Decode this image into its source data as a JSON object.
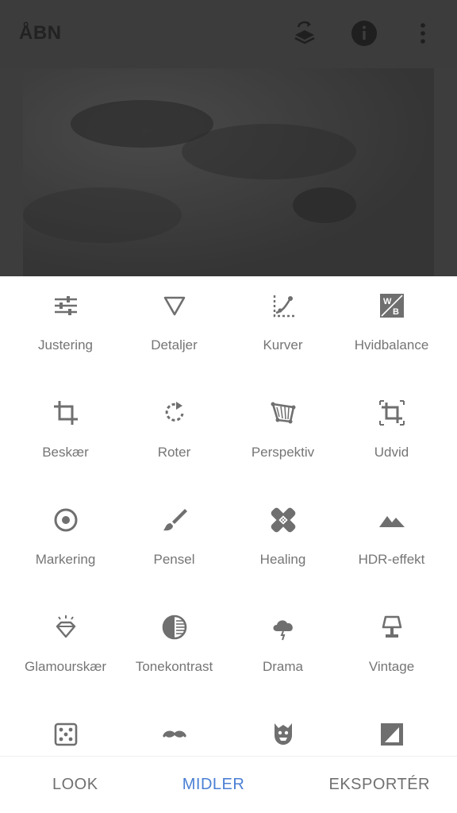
{
  "header": {
    "title": "ÅBN",
    "icons": [
      "stack-swap-icon",
      "info-icon",
      "more-vert-icon"
    ]
  },
  "tools": [
    {
      "label": "Justering",
      "icon": "sliders-icon"
    },
    {
      "label": "Detaljer",
      "icon": "triangle-icon"
    },
    {
      "label": "Kurver",
      "icon": "curves-icon"
    },
    {
      "label": "Hvidbalance",
      "icon": "white-balance-icon"
    },
    {
      "label": "Beskær",
      "icon": "crop-icon"
    },
    {
      "label": "Roter",
      "icon": "rotate-icon"
    },
    {
      "label": "Perspektiv",
      "icon": "perspective-icon"
    },
    {
      "label": "Udvid",
      "icon": "expand-icon"
    },
    {
      "label": "Markering",
      "icon": "target-icon"
    },
    {
      "label": "Pensel",
      "icon": "brush-icon"
    },
    {
      "label": "Healing",
      "icon": "bandage-icon"
    },
    {
      "label": "HDR-effekt",
      "icon": "mountains-icon"
    },
    {
      "label": "Glamourskær",
      "icon": "diamond-icon"
    },
    {
      "label": "Tonekontrast",
      "icon": "tonal-contrast-icon"
    },
    {
      "label": "Drama",
      "icon": "storm-cloud-icon"
    },
    {
      "label": "Vintage",
      "icon": "lamp-icon"
    },
    {
      "label": "",
      "icon": "dice-icon"
    },
    {
      "label": "",
      "icon": "mustache-icon"
    },
    {
      "label": "",
      "icon": "monster-icon"
    },
    {
      "label": "",
      "icon": "frame-icon"
    }
  ],
  "bottom_nav": {
    "look": "LOOK",
    "tools": "MIDLER",
    "export": "EKSPORTÉR"
  },
  "colors": {
    "accent": "#4a7fd4",
    "icon": "#6f6f6f",
    "label": "#757575",
    "dim_overlay": "#3c3c3c"
  }
}
